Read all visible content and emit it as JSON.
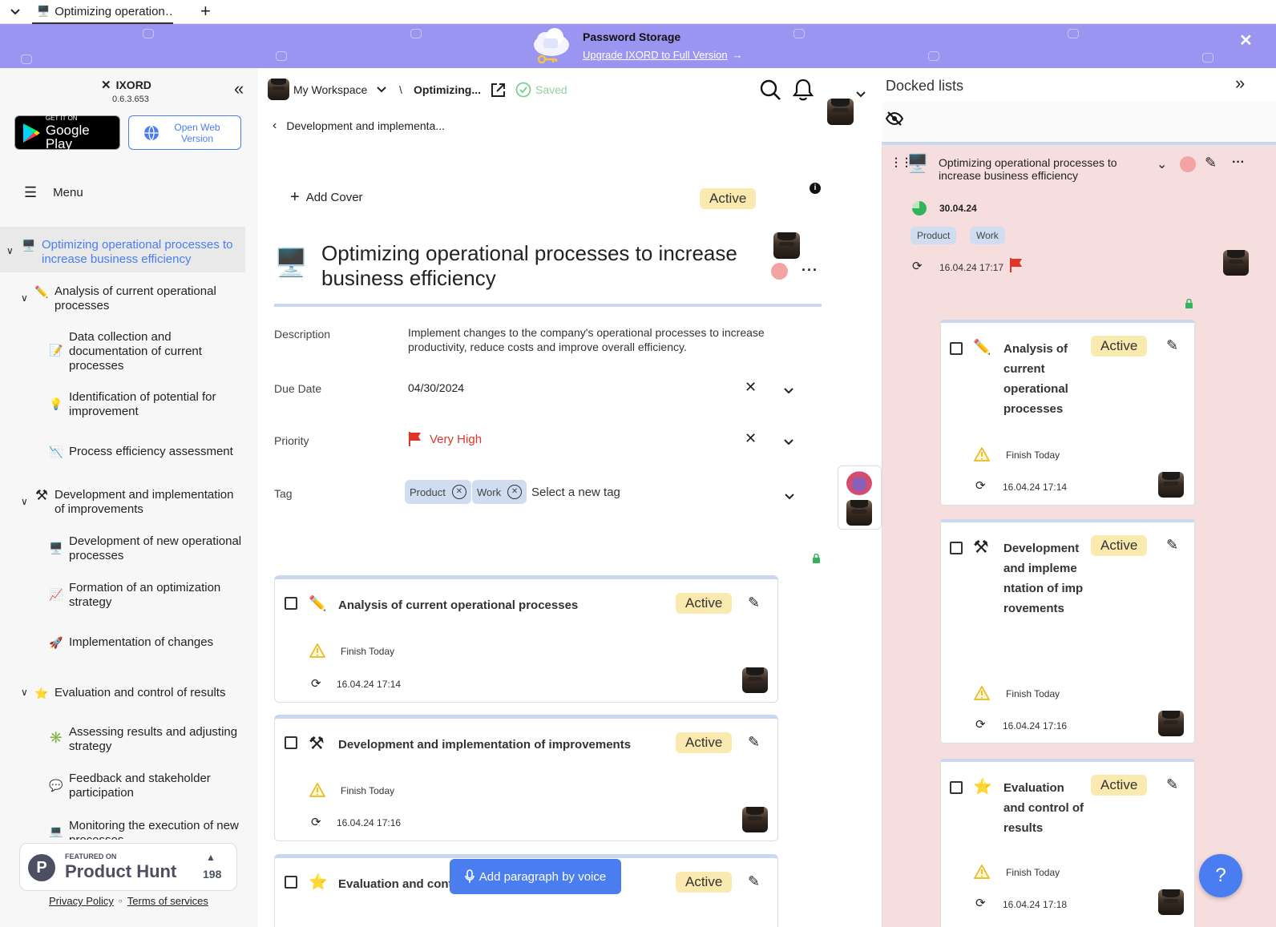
{
  "browser_tab": {
    "title": "Optimizing operation…"
  },
  "banner": {
    "title": "Password Storage",
    "link": "Upgrade IXORD to Full Version"
  },
  "sidebar": {
    "brand": "IXORD",
    "version": "0.6.3.653",
    "google_play_small": "GET IT ON",
    "google_play_big": "Google Play",
    "web_button": "Open Web Version",
    "menu_label": "Menu",
    "tree": [
      {
        "label": "Optimizing operational processes to increase business efficiency",
        "emoji": "🖥️"
      },
      {
        "label": "Analysis of current operational processes",
        "emoji": "✏️"
      },
      {
        "label": "Data collection and documentation of current processes",
        "emoji": "📝"
      },
      {
        "label": "Identification of potential for improvement",
        "emoji": "💡"
      },
      {
        "label": "Process efficiency assessment",
        "emoji": "📉"
      },
      {
        "label": "Development and implementation of improvements",
        "emoji": "⚒"
      },
      {
        "label": "Development of new operational processes",
        "emoji": "🖥️"
      },
      {
        "label": "Formation of an optimization strategy",
        "emoji": "📈"
      },
      {
        "label": "Implementation of changes",
        "emoji": "🚀"
      },
      {
        "label": "Evaluation and control of results",
        "emoji": "⭐"
      },
      {
        "label": "Assessing results and adjusting strategy",
        "emoji": "✳️"
      },
      {
        "label": "Feedback and stakeholder participation",
        "emoji": "💬"
      },
      {
        "label": "Monitoring the execution of new processes",
        "emoji": "💻"
      }
    ],
    "ph_featured": "FEATURED ON",
    "ph_name": "Product Hunt",
    "ph_count": "198",
    "privacy": "Privacy Policy",
    "terms": "Terms of services"
  },
  "header": {
    "workspace": "My Workspace",
    "breadcrumb_sep": "\\",
    "crumb": "Optimizing...",
    "saved": "Saved"
  },
  "main": {
    "back": "Development and implementa...",
    "add_cover": "Add Cover",
    "status": "Active",
    "title": "Optimizing operational processes to increase business efficiency",
    "description_label": "Description",
    "description": "Implement changes to the company's operational processes to increase productivity, reduce costs and improve overall efficiency.",
    "due_label": "Due Date",
    "due_value": "04/30/2024",
    "priority_label": "Priority",
    "priority_value": "Very High",
    "tag_label": "Tag",
    "tags": [
      "Product",
      "Work"
    ],
    "tag_placeholder": "Select a new tag",
    "voice_button": "Add paragraph by voice",
    "cards": [
      {
        "title": "Analysis of current operational processes",
        "emoji": "✏️",
        "status": "Active",
        "due": "Finish Today",
        "date": "16.04.24 17:14"
      },
      {
        "title": "Development and implementation of improvements",
        "emoji": "⚒",
        "status": "Active",
        "due": "Finish Today",
        "date": "16.04.24 17:16"
      },
      {
        "title": "Evaluation and cont",
        "emoji": "⭐",
        "status": "Active"
      }
    ]
  },
  "docked": {
    "title": "Docked lists",
    "list_title": "Optimizing operational processes to increase business efficiency",
    "date": "30.04.24",
    "tags": [
      "Product",
      "Work"
    ],
    "updated": "16.04.24 17:17",
    "cards": [
      {
        "title": "Analysis of current operational processes",
        "emoji": "✏️",
        "status": "Active",
        "due": "Finish Today",
        "date": "16.04.24 17:14"
      },
      {
        "title": "Development and implementation of improvements",
        "emoji": "⚒",
        "status": "Active",
        "due": "Finish Today",
        "date": "16.04.24 17:16"
      },
      {
        "title": "Evaluation and control of results",
        "emoji": "⭐",
        "status": "Active",
        "due": "Finish Today",
        "date": "16.04.24 17:18"
      }
    ]
  },
  "help_button": "?",
  "colors": {
    "accent": "#4a7df0",
    "banner": "#9b95f2",
    "active_badge": "#fbeaaf",
    "docked_bg": "#f6dede",
    "priority": "#e0352b"
  }
}
